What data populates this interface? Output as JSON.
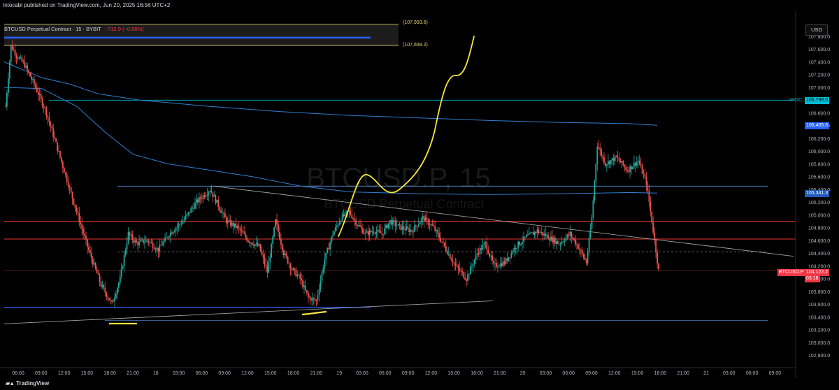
{
  "header": {
    "publisher_text": "Intocabl published on TradingView.com, Jun 20, 2025 16:56 UTC+2"
  },
  "symbol": {
    "title": "BTCUSD Perpetual Contract · 15 · BYBIT",
    "change": "−712.9 (−0.68%)",
    "currency": "USD",
    "watermark_ticker": "BTCUSD.P, 15",
    "watermark_name": "BTCUSD Perpetual Contract"
  },
  "zones": {
    "upper_label": "(107,993.6)",
    "lower_label": "(107,658.2)"
  },
  "price_axis": {
    "ticks": [
      "107,800.0",
      "107,600.0",
      "107,400.0",
      "107,200.0",
      "107,000.0",
      "106,600.0",
      "106,400.0",
      "106,200.0",
      "106,000.0",
      "105,800.0",
      "105,600.0",
      "105,400.0",
      "105,200.0",
      "105,000.0",
      "104,800.0",
      "104,600.0",
      "104,400.0",
      "104,200.0",
      "104,000.0",
      "103,800.0",
      "103,600.0",
      "103,400.0",
      "103,200.0",
      "103,000.0",
      "102,800.0"
    ],
    "tick_values": [
      107800,
      107600,
      107400,
      107200,
      107000,
      106600,
      106400,
      106200,
      106000,
      105800,
      105600,
      105400,
      105200,
      105000,
      104800,
      104600,
      104400,
      104200,
      104000,
      103800,
      103600,
      103400,
      103200,
      103000,
      102800
    ]
  },
  "badges": {
    "npoc_label": "nPOC",
    "npoc_value": "106,799.0",
    "vwap_upper": "106,405.6",
    "vwap_lower": "105,341.3",
    "current_symbol": "BTCUSD.P",
    "current_price": "104,122.2",
    "countdown": "03:18"
  },
  "time_axis": {
    "labels": [
      "06:00",
      "09:00",
      "12:00",
      "15:00",
      "18:00",
      "21:00",
      "18",
      "03:00",
      "06:00",
      "09:00",
      "12:00",
      "15:00",
      "18:00",
      "21:00",
      "19",
      "03:00",
      "06:00",
      "09:00",
      "12:00",
      "15:00",
      "18:00",
      "21:00",
      "20",
      "03:00",
      "06:00",
      "09:00",
      "12:00",
      "15:00",
      "18:00",
      "21:00",
      "21",
      "03:00",
      "06:00",
      "09:00"
    ]
  },
  "footer": {
    "brand": "TradingView"
  },
  "colors": {
    "background": "#000000",
    "bull": "#26a69a",
    "bear": "#ef5350",
    "red_line": "#e53935",
    "blue_line": "#2962ff",
    "vwap": "#2f7fd0",
    "zone": "#e8d96a",
    "current_badge": "#f23645",
    "npoc_badge": "#00bcd4"
  },
  "chart_data": {
    "type": "candlestick",
    "symbol": "BTCUSD.P",
    "timeframe": "15",
    "exchange": "BYBIT",
    "ylim": [
      102700,
      108000
    ],
    "last_price": 104122.2,
    "levels": {
      "zone_top": 107993.6,
      "zone_bottom": 107658.2,
      "npoc": 106799.0,
      "vwap_upper": 106405.6,
      "vwap_lower": 105341.3,
      "range_high": 105450,
      "red_level_1": 104900,
      "red_level_2": 104620,
      "mid_dashed": 104420,
      "range_low": 103340,
      "blue_support": 103550
    },
    "price_path": [
      [
        0,
        106700
      ],
      [
        4,
        107650
      ],
      [
        8,
        107500
      ],
      [
        14,
        107350
      ],
      [
        22,
        107000
      ],
      [
        30,
        106600
      ],
      [
        40,
        105900
      ],
      [
        50,
        105200
      ],
      [
        60,
        104500
      ],
      [
        70,
        103900
      ],
      [
        78,
        103600
      ],
      [
        84,
        104000
      ],
      [
        90,
        104700
      ],
      [
        96,
        104550
      ],
      [
        104,
        104600
      ],
      [
        112,
        104450
      ],
      [
        120,
        104700
      ],
      [
        130,
        104900
      ],
      [
        140,
        105200
      ],
      [
        150,
        105400
      ],
      [
        156,
        105150
      ],
      [
        162,
        104900
      ],
      [
        170,
        104800
      ],
      [
        178,
        104600
      ],
      [
        186,
        104500
      ],
      [
        192,
        104100
      ],
      [
        198,
        104900
      ],
      [
        204,
        104400
      ],
      [
        210,
        104150
      ],
      [
        216,
        104000
      ],
      [
        222,
        103700
      ],
      [
        228,
        103650
      ],
      [
        234,
        104300
      ],
      [
        240,
        104700
      ],
      [
        246,
        104950
      ],
      [
        252,
        105050
      ],
      [
        258,
        104850
      ],
      [
        264,
        104700
      ],
      [
        270,
        104750
      ],
      [
        276,
        104700
      ],
      [
        282,
        104900
      ],
      [
        290,
        104800
      ],
      [
        298,
        104750
      ],
      [
        306,
        104950
      ],
      [
        314,
        104800
      ],
      [
        322,
        104500
      ],
      [
        330,
        104200
      ],
      [
        338,
        104000
      ],
      [
        346,
        104400
      ],
      [
        352,
        104550
      ],
      [
        358,
        104200
      ],
      [
        366,
        104250
      ],
      [
        374,
        104500
      ],
      [
        382,
        104650
      ],
      [
        390,
        104750
      ],
      [
        398,
        104650
      ],
      [
        406,
        104550
      ],
      [
        414,
        104700
      ],
      [
        420,
        104500
      ],
      [
        426,
        104250
      ],
      [
        430,
        104950
      ],
      [
        434,
        106100
      ],
      [
        440,
        105800
      ],
      [
        448,
        105900
      ],
      [
        456,
        105700
      ],
      [
        464,
        105850
      ],
      [
        470,
        105500
      ],
      [
        476,
        104600
      ],
      [
        479,
        104122
      ]
    ]
  }
}
